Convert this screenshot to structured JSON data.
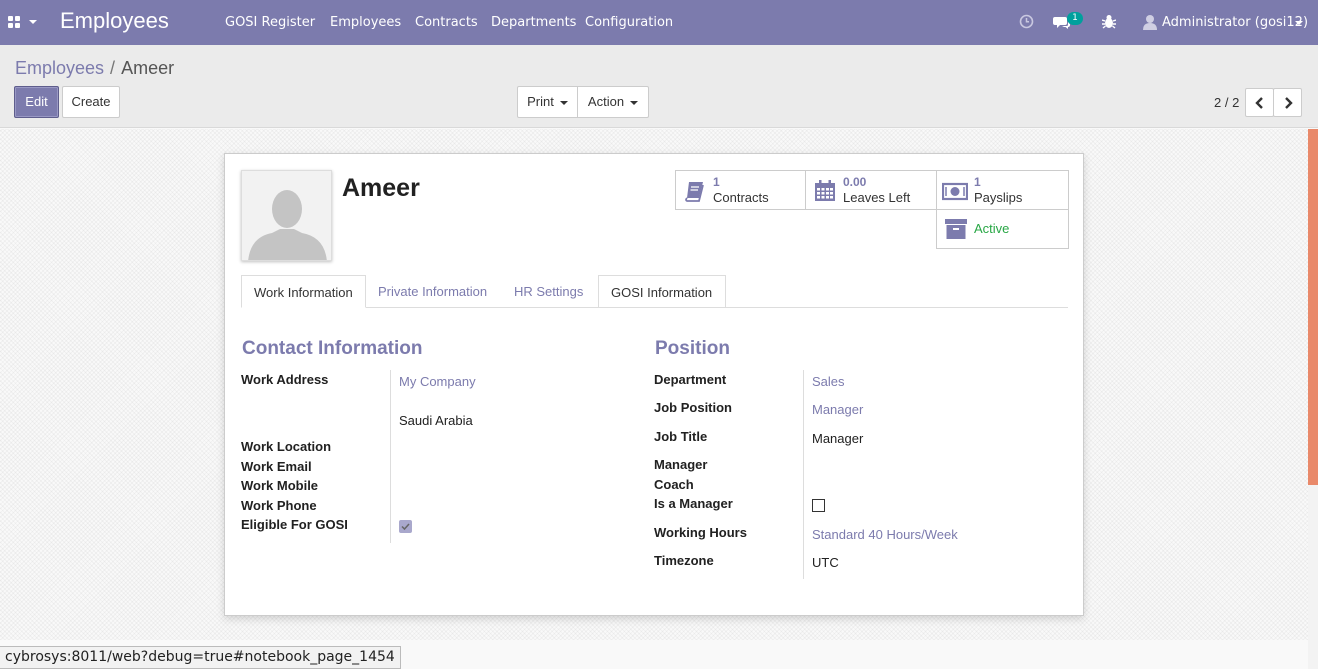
{
  "navbar": {
    "app_title": "Employees",
    "menu": [
      "GOSI Register",
      "Employees",
      "Contracts",
      "Departments",
      "Configuration"
    ],
    "messages_count": "1",
    "user": "Administrator (gosi12)",
    "icons": [
      "apps-icon",
      "clock-icon",
      "chat-icon",
      "bug-icon",
      "user-icon"
    ],
    "bg_color": "#7c7bad"
  },
  "breadcrumb": {
    "parent": "Employees",
    "separator": "/",
    "current": "Ameer"
  },
  "toolbar": {
    "edit_label": "Edit",
    "create_label": "Create",
    "print_label": "Print",
    "action_label": "Action"
  },
  "pager": {
    "value": "2 / 2"
  },
  "employee": {
    "name": "Ameer"
  },
  "stat_buttons": {
    "contracts": {
      "value": "1",
      "label": "Contracts",
      "icon": "book-icon"
    },
    "leaves": {
      "value": "0.00",
      "label": "Leaves Left",
      "icon": "calendar-icon"
    },
    "payslips": {
      "value": "1",
      "label": "Payslips",
      "icon": "money-icon"
    },
    "active": {
      "label": "Active",
      "icon": "archive-icon",
      "color": "#28a745"
    }
  },
  "tabs": [
    "Work Information",
    "Private Information",
    "HR Settings",
    "GOSI Information"
  ],
  "contact": {
    "title": "Contact Information",
    "labels": {
      "work_address": "Work Address",
      "work_location": "Work Location",
      "work_email": "Work Email",
      "work_mobile": "Work Mobile",
      "work_phone": "Work Phone",
      "eligible_gosi": "Eligible For GOSI"
    },
    "values": {
      "company": "My Company",
      "country": "Saudi Arabia",
      "eligible_gosi_checked": true
    }
  },
  "position": {
    "title": "Position",
    "labels": {
      "department": "Department",
      "job_position": "Job Position",
      "job_title": "Job Title",
      "manager": "Manager",
      "coach": "Coach",
      "is_manager": "Is a Manager",
      "working_hours": "Working Hours",
      "timezone": "Timezone"
    },
    "values": {
      "department": "Sales",
      "job_position": "Manager",
      "job_title": "Manager",
      "is_manager_checked": false,
      "working_hours": "Standard 40 Hours/Week",
      "timezone": "UTC"
    }
  },
  "status_bar": {
    "url": "cybrosys:8011/web?debug=true#notebook_page_1454"
  }
}
